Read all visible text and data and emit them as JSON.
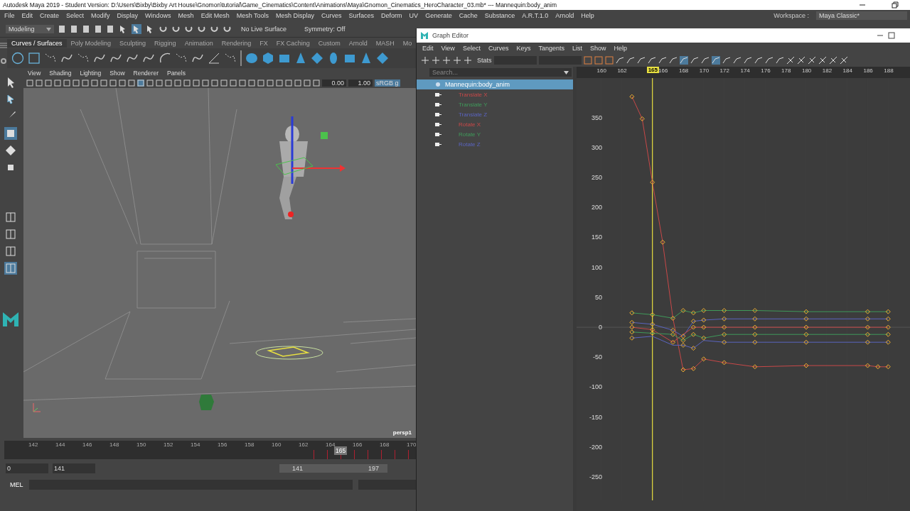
{
  "title_bar": {
    "title": "Autodesk Maya 2019 - Student Version: D:\\Users\\Bixby\\Bixby Art House\\Gnomon\\tutorial\\Game_Cinematics\\Content\\Animations\\Maya\\Gnomon_Cinematics_HeroCharacter_03.mb* --- Mannequin:body_anim"
  },
  "menu_bar": [
    "File",
    "Edit",
    "Create",
    "Select",
    "Modify",
    "Display",
    "Windows",
    "Mesh",
    "Edit Mesh",
    "Mesh Tools",
    "Mesh Display",
    "Curves",
    "Surfaces",
    "Deform",
    "UV",
    "Generate",
    "Cache",
    "Substance",
    "A.R.T.1.0",
    "Arnold",
    "Help"
  ],
  "workspace": {
    "label": "Workspace :",
    "value": "Maya Classic*"
  },
  "status_line": {
    "mode": "Modeling",
    "live_surface": "No Live Surface",
    "symmetry": "Symmetry: Off"
  },
  "shelf": {
    "tabs": [
      {
        "label": "Curves / Surfaces",
        "selected": true
      },
      {
        "label": "Poly Modeling",
        "selected": false
      },
      {
        "label": "Sculpting",
        "selected": false
      },
      {
        "label": "Rigging",
        "selected": false
      },
      {
        "label": "Animation",
        "selected": false
      },
      {
        "label": "Rendering",
        "selected": false
      },
      {
        "label": "FX",
        "selected": false
      },
      {
        "label": "FX Caching",
        "selected": false
      },
      {
        "label": "Custom",
        "selected": false
      },
      {
        "label": "Arnold",
        "selected": false
      },
      {
        "label": "MASH",
        "selected": false
      },
      {
        "label": "Mo",
        "selected": false
      }
    ]
  },
  "viewport": {
    "menu": [
      "View",
      "Shading",
      "Lighting",
      "Show",
      "Renderer",
      "Panels"
    ],
    "exposure": "0.00",
    "gamma": "1.00",
    "color_space": "sRGB g",
    "camera": "persp1"
  },
  "time_slider": {
    "ticks": [
      "142",
      "144",
      "146",
      "148",
      "150",
      "152",
      "154",
      "156",
      "158",
      "160",
      "162",
      "164",
      "166",
      "168",
      "170"
    ],
    "current": "165"
  },
  "range_slider": {
    "start": "0",
    "playback_start": "141",
    "range_start": "141",
    "range_end": "197"
  },
  "command_line": {
    "label": "MEL"
  },
  "graph_editor": {
    "title": "Graph Editor",
    "menu": [
      "Edit",
      "View",
      "Select",
      "Curves",
      "Keys",
      "Tangents",
      "List",
      "Show",
      "Help"
    ],
    "stats_label": "Stats",
    "search": {
      "placeholder": "Search..."
    },
    "outliner": {
      "label": "Mannequin:body_anim",
      "selected": true
    },
    "current_frame": "165",
    "chart_data": {
      "type": "line",
      "x": [
        163,
        164,
        165,
        166,
        167,
        168,
        169,
        170,
        172,
        175,
        180,
        186,
        187,
        188
      ],
      "xlim": [
        157.6,
        190.2
      ],
      "ylim": [
        -289,
        416
      ],
      "xticks": [
        160,
        162,
        166,
        168,
        170,
        172,
        174,
        176,
        178,
        180,
        182,
        184,
        186,
        188
      ],
      "yticks": [
        350,
        300,
        250,
        200,
        150,
        100,
        50,
        0,
        -50,
        -100,
        -150,
        -200,
        -250
      ],
      "ref_lines": [
        {
          "axis": "x",
          "value": 165
        }
      ],
      "series": [
        {
          "name": "Translate X",
          "color": "#c84848",
          "marker": "diamond",
          "values": [
            385,
            348,
            242,
            142,
            15,
            -71,
            -69,
            -53,
            -59,
            -66,
            -64,
            -64,
            -66,
            -66
          ]
        },
        {
          "name": "Translate Y",
          "color": "#3f9a5a",
          "marker": "diamond",
          "values": [
            24,
            null,
            21,
            null,
            15,
            28,
            24,
            28,
            28,
            28,
            26,
            26,
            null,
            26
          ]
        },
        {
          "name": "Translate Z",
          "color": "#5a64c0",
          "marker": "diamond",
          "values": [
            8,
            null,
            5,
            null,
            -5,
            -15,
            10,
            12,
            14,
            14,
            14,
            14,
            null,
            14
          ]
        },
        {
          "name": "Rotate X",
          "color": "#c84848",
          "marker": "diamond",
          "values": [
            0,
            null,
            -4,
            null,
            -25,
            -12,
            0,
            0,
            0,
            0,
            0,
            0,
            null,
            0
          ]
        },
        {
          "name": "Rotate Y",
          "color": "#3f9a5a",
          "marker": "diamond",
          "values": [
            -8,
            null,
            -10,
            null,
            -12,
            -22,
            -12,
            -18,
            -12,
            -12,
            -12,
            -12,
            null,
            -12
          ]
        },
        {
          "name": "Rotate Z",
          "color": "#5a64c0",
          "marker": "diamond",
          "values": [
            -18,
            null,
            -15,
            null,
            -30,
            -30,
            -35,
            -22,
            -25,
            -25,
            -25,
            -25,
            null,
            -25
          ]
        }
      ]
    }
  }
}
